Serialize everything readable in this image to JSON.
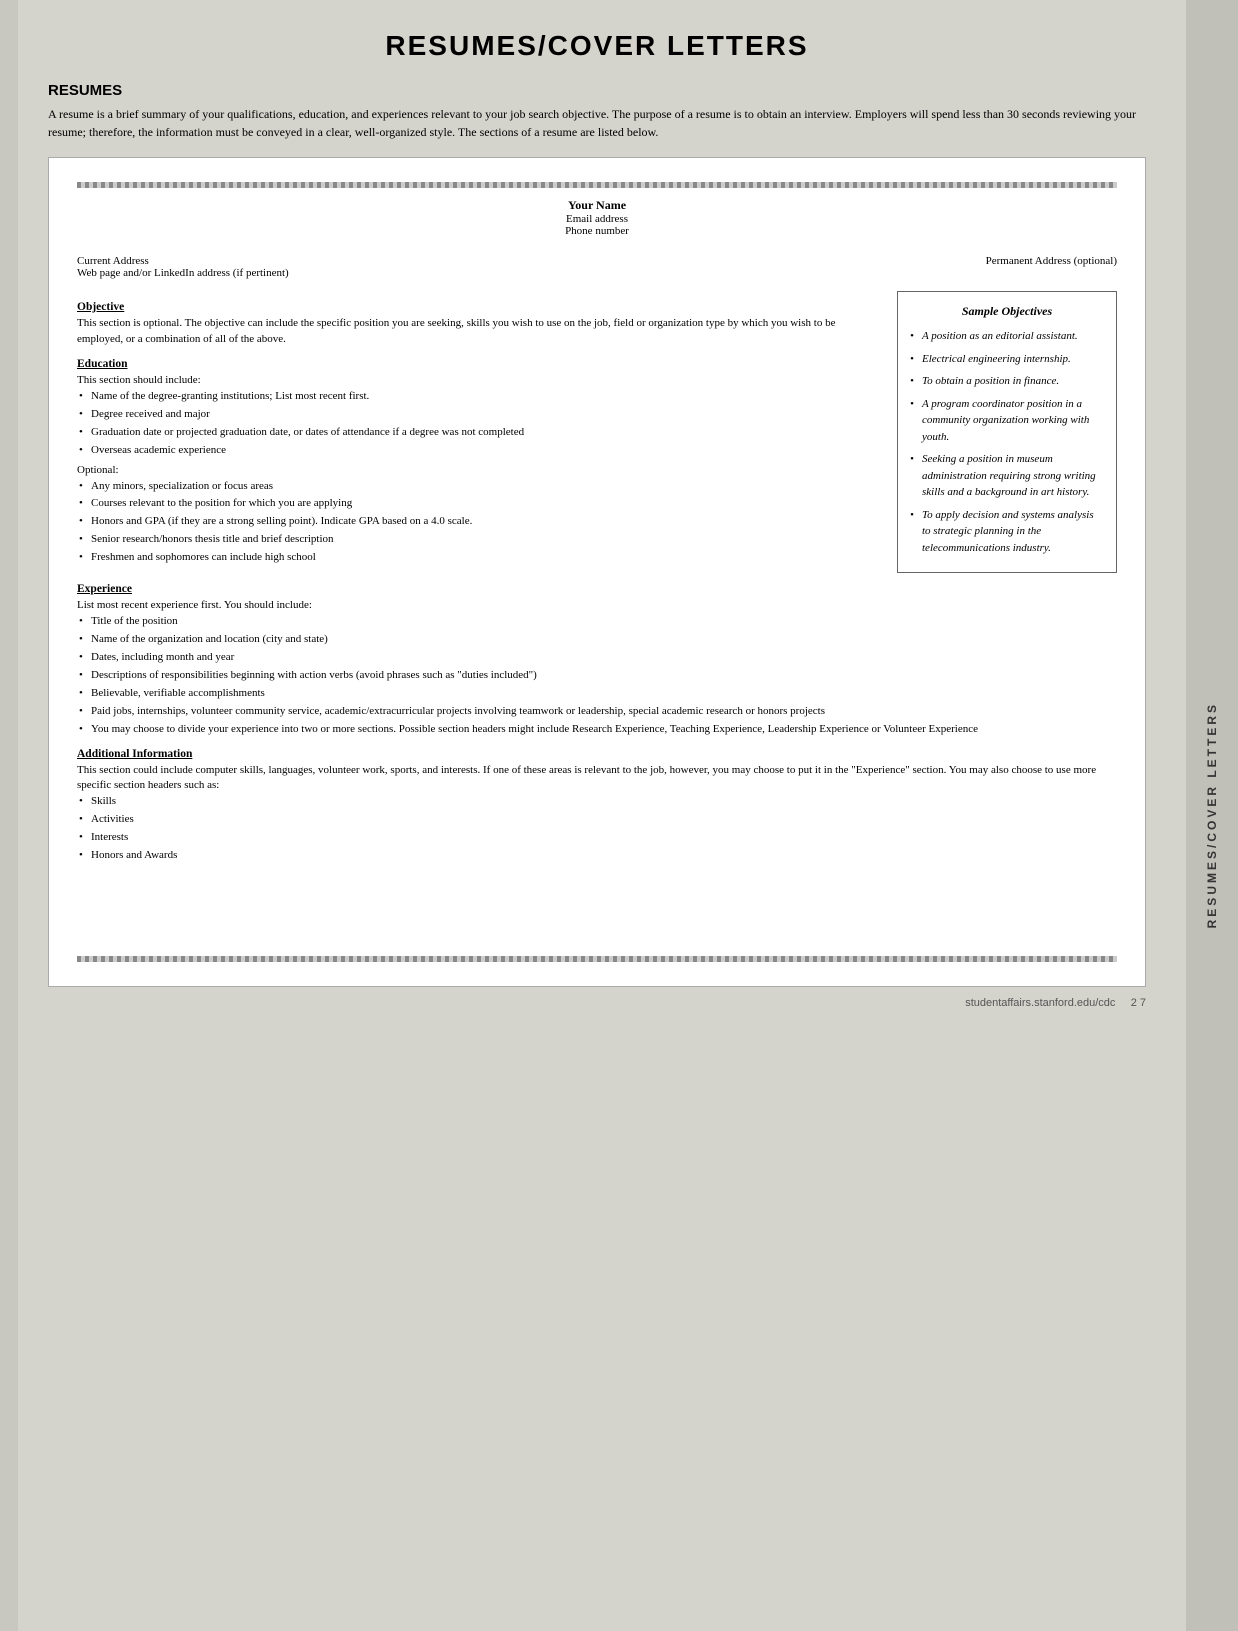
{
  "page": {
    "title": "RESUMES/COVER LETTERS",
    "footer": "studentaffairs.stanford.edu/cdc",
    "page_number": "2 7"
  },
  "resumes_section": {
    "heading": "RESUMES",
    "intro": "A resume is a brief summary of your qualifications, education, and experiences relevant to your job search objective. The purpose of a resume is to obtain an interview. Employers will spend less than 30 seconds reviewing your resume; therefore, the information must be conveyed in a clear, well-organized style. The sections of a resume are listed below."
  },
  "resume_template": {
    "your_name": "Your Name",
    "email": "Email address",
    "phone": "Phone number",
    "current_address": "Current Address",
    "web": "Web page and/or LinkedIn address (if pertinent)",
    "permanent_address": "Permanent Address (optional)"
  },
  "objective_section": {
    "title": "Objective",
    "text": "This section is optional. The objective can include the specific position you are seeking, skills you wish to use on the job, field or organization type by which you wish to be employed, or a combination of all of the above."
  },
  "sample_objectives": {
    "box_title": "Sample Objectives",
    "items": [
      "A position as an editorial assistant.",
      "Electrical engineering internship.",
      "To obtain a position in finance.",
      "A program coordinator position in a community organization working with youth.",
      "Seeking a position in museum administration requiring strong writing skills and a background in art history.",
      "To apply decision and systems analysis to strategic planning in the telecommunications industry."
    ]
  },
  "education_section": {
    "title": "Education",
    "intro": "This section should include:",
    "items": [
      "Name of the degree-granting institutions; List most recent first.",
      "Degree received and major",
      "Graduation date or projected graduation date, or dates of attendance if a degree was not completed",
      "Overseas academic experience"
    ],
    "optional_label": "Optional:",
    "optional_items": [
      "Any minors, specialization or focus areas",
      "Courses relevant to the position for which you are applying",
      "Honors and GPA (if they are a strong selling point). Indicate GPA based on a 4.0 scale.",
      "Senior research/honors thesis title and brief description",
      "Freshmen and sophomores can include high school"
    ]
  },
  "experience_section": {
    "title": "Experience",
    "intro": "List most recent experience first. You should include:",
    "items": [
      "Title of the position",
      "Name of the organization and location (city and state)",
      "Dates, including month and year",
      "Descriptions of responsibilities beginning with action verbs (avoid phrases such as \"duties included\")",
      "Believable, verifiable accomplishments",
      "Paid jobs, internships, volunteer community service, academic/extracurricular projects involving teamwork or leadership, special academic research or honors projects",
      "You may choose to divide your experience into two or more sections. Possible section headers might include Research Experience, Teaching Experience, Leadership Experience or Volunteer Experience"
    ]
  },
  "additional_info_section": {
    "title": "Additional Information",
    "text": "This section could include computer skills, languages, volunteer work, sports, and interests. If one of these areas is relevant to the job, however, you may choose to put it in the \"Experience\" section. You may also choose to use more specific section headers such as:",
    "items": [
      "Skills",
      "Activities",
      "Interests",
      "Honors and Awards"
    ]
  },
  "side_tab": {
    "label": "RESUMES/COVER LETTERS"
  }
}
